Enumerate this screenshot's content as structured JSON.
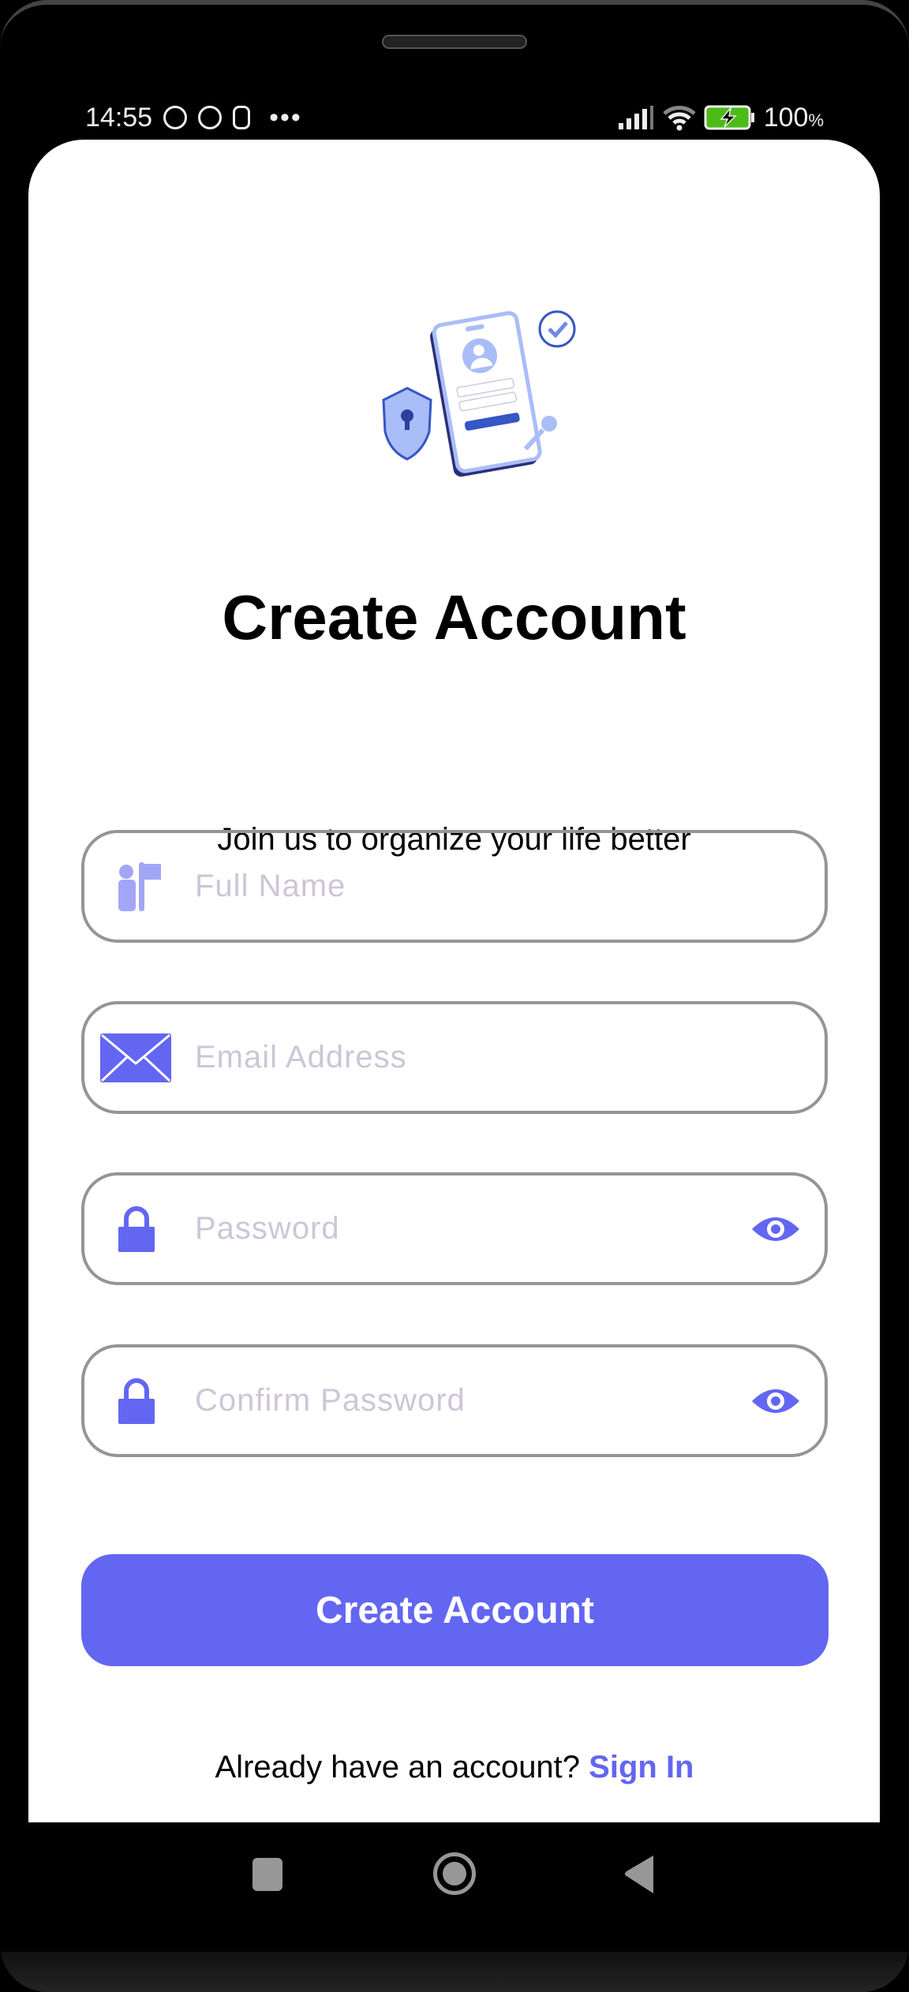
{
  "status_bar": {
    "time": "14:55",
    "battery": "100",
    "battery_unit": "%"
  },
  "header": {
    "title": "Create Account",
    "subtitle": "Join us to organize your life better"
  },
  "form": {
    "full_name": {
      "placeholder": "Full Name",
      "value": "",
      "icon": "person-flag-icon"
    },
    "email": {
      "placeholder": "Email Address",
      "value": "",
      "icon": "mail-icon"
    },
    "password": {
      "placeholder": "Password",
      "value": "",
      "icon": "lock-icon"
    },
    "confirm_password": {
      "placeholder": "Confirm Password",
      "value": "",
      "icon": "lock-icon"
    }
  },
  "actions": {
    "create_label": "Create Account"
  },
  "footer": {
    "prompt": "Already have an account?",
    "link": "Sign In"
  },
  "colors": {
    "accent": "#6366f1",
    "placeholder": "#cdc6d6",
    "border": "#959595"
  }
}
